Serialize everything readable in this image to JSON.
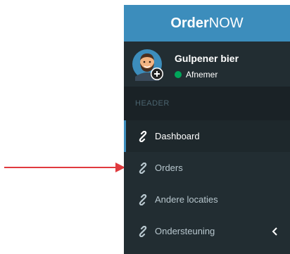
{
  "brand": {
    "strong": "Order",
    "light": "NOW"
  },
  "user": {
    "name": "Gulpener bier",
    "status": "Afnemer"
  },
  "menu": {
    "header": "HEADER",
    "items": [
      {
        "label": "Dashboard",
        "icon": "link-icon",
        "active": true
      },
      {
        "label": "Orders",
        "icon": "link-icon",
        "active": false
      },
      {
        "label": "Andere locaties",
        "icon": "link-icon",
        "active": false
      },
      {
        "label": "Ondersteuning",
        "icon": "link-icon",
        "active": false,
        "has_submenu": true
      }
    ]
  },
  "colors": {
    "brand_bar": "#3c8dbc",
    "sidebar_bg": "#222d32",
    "header_bg": "#1a2226",
    "status_online": "#00a65a",
    "annotation_arrow": "#e03a3e"
  }
}
